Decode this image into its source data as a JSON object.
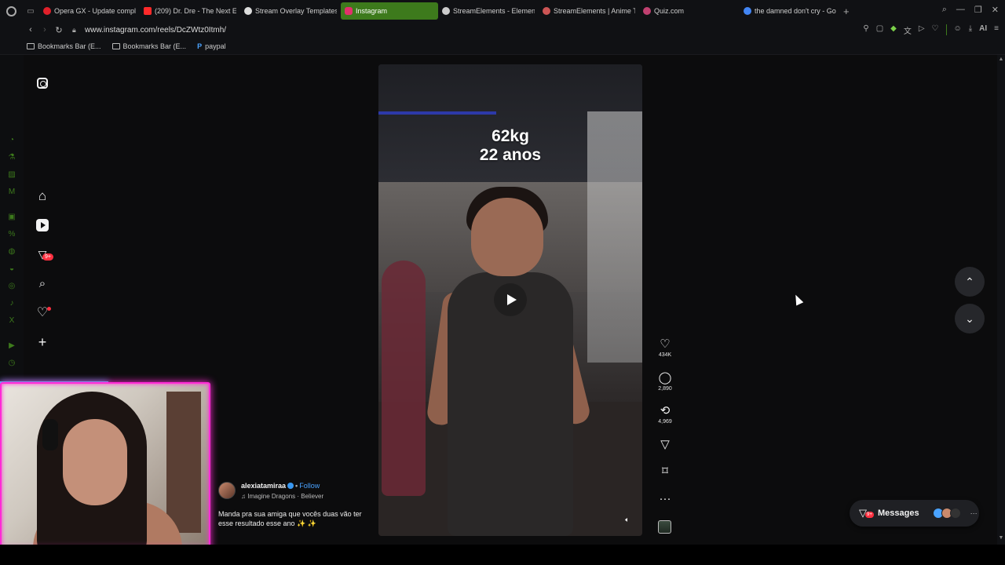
{
  "browser": {
    "tabs": [
      {
        "label": "Opera GX - Update comple",
        "color": "#e0202a",
        "active": false
      },
      {
        "label": "(209) Dr. Dre - The Next E",
        "color": "#ff2a2a",
        "active": false
      },
      {
        "label": "Stream Overlay Templates",
        "color": "#dddddd",
        "active": false
      },
      {
        "label": "Instagram",
        "color": "#e1306c",
        "active": true
      },
      {
        "label": "StreamElements - Elemen",
        "color": "#cccccc",
        "active": false
      },
      {
        "label": "StreamElements | Anime T",
        "color": "#cc5555",
        "active": false
      },
      {
        "label": "Quiz.com",
        "color": "#c04070",
        "active": false
      },
      {
        "label": "the damned don't cry - Goo",
        "color": "#4285f4",
        "active": false
      }
    ],
    "url": "www.instagram.com/reels/DcZWtz0Itmh/",
    "bookmarks": [
      {
        "label": "Bookmarks Bar (E..."
      },
      {
        "label": "Bookmarks Bar (E..."
      },
      {
        "label": "paypal"
      }
    ],
    "ai_label": "AI"
  },
  "instagram": {
    "nav_badge": "9+",
    "reel": {
      "overlay_line1": "62kg",
      "overlay_line2": "22 anos"
    },
    "actions": {
      "likes": "434K",
      "comments": "2,890",
      "reposts": "4,969"
    },
    "caption": {
      "username": "alexiatamiraa",
      "follow": "Follow",
      "audio": "Imagine Dragons · Believer",
      "text": "Manda pra sua amiga que vocês duas vão ter esse resultado esse ano ✨ ✨"
    },
    "messages": {
      "label": "Messages",
      "badge": "9+"
    }
  },
  "colors": {
    "accent_green": "#3d7a1c",
    "overlay_pink": "#ff2bd6",
    "overlay_cyan": "#2bd4ff",
    "ig_red": "#ff3040",
    "ig_blue": "#4aa3ff"
  },
  "icons": [
    "opera-icon",
    "back-icon",
    "forward-icon",
    "reload-icon",
    "lock-icon",
    "instagram-icon",
    "home-icon",
    "reels-icon",
    "send-icon",
    "search-icon",
    "heart-icon",
    "plus-icon",
    "play-icon",
    "comment-icon",
    "repost-icon",
    "bookmark-icon",
    "more-icon",
    "chevron-up-icon",
    "chevron-down-icon",
    "volume-icon"
  ]
}
